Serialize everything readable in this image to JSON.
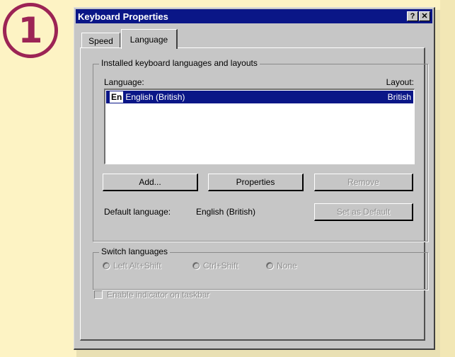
{
  "step_number": "1",
  "window": {
    "title": "Keyboard Properties",
    "help_glyph": "?",
    "close_glyph": "✕"
  },
  "tabs": [
    {
      "label": "Speed",
      "selected": false
    },
    {
      "label": "Language",
      "selected": true
    }
  ],
  "installed_group": {
    "title": "Installed keyboard languages and layouts",
    "language_header": "Language:",
    "layout_header": "Layout:",
    "items": [
      {
        "code": "En",
        "language": "English (British)",
        "layout": "British",
        "selected": true
      }
    ]
  },
  "buttons": {
    "add": "Add...",
    "properties": "Properties",
    "remove": "Remove",
    "set_default": "Set as Default"
  },
  "default_language": {
    "label": "Default language:",
    "value": "English (British)"
  },
  "switch_group": {
    "title": "Switch languages",
    "options": [
      "Left Alt+Shift",
      "Ctrl+Shift",
      "None"
    ]
  },
  "indicator_checkbox": {
    "label": "Enable indicator on taskbar",
    "checked": false
  },
  "colors": {
    "titlebar": "#0a1687",
    "accent": "#9c2455",
    "face": "#c6c6c6",
    "background": "#fdf3c4"
  }
}
